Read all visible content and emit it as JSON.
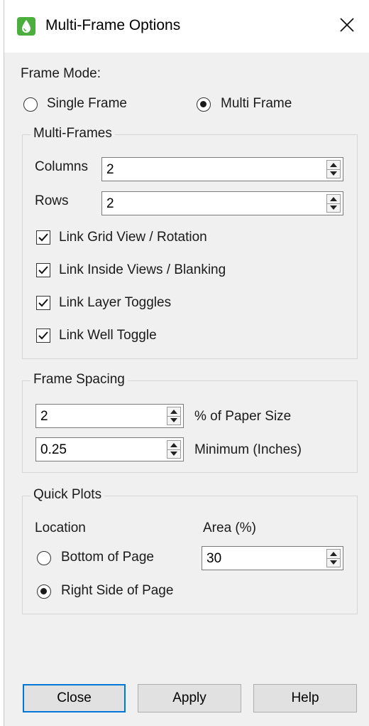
{
  "window": {
    "title": "Multi-Frame Options",
    "icon": "water-drop-icon"
  },
  "frame_mode": {
    "label": "Frame Mode:",
    "options": [
      {
        "label": "Single Frame",
        "checked": false
      },
      {
        "label": "Multi Frame",
        "checked": true
      }
    ]
  },
  "multi_frames": {
    "title": "Multi-Frames",
    "columns_label": "Columns",
    "columns_value": "2",
    "rows_label": "Rows",
    "rows_value": "2",
    "checkboxes": [
      {
        "label": "Link Grid View / Rotation",
        "checked": true
      },
      {
        "label": "Link Inside Views / Blanking",
        "checked": true
      },
      {
        "label": "Link Layer Toggles",
        "checked": true
      },
      {
        "label": "Link Well Toggle",
        "checked": true
      }
    ]
  },
  "frame_spacing": {
    "title": "Frame Spacing",
    "paper_value": "2",
    "paper_label": "% of Paper Size",
    "minimum_value": "0.25",
    "minimum_label": "Minimum (Inches)"
  },
  "quick_plots": {
    "title": "Quick Plots",
    "location_label": "Location",
    "area_label": "Area (%)",
    "area_value": "30",
    "locations": [
      {
        "label": "Bottom of Page",
        "checked": false
      },
      {
        "label": "Right Side of Page",
        "checked": true
      }
    ]
  },
  "buttons": {
    "close": "Close",
    "apply": "Apply",
    "help": "Help"
  }
}
